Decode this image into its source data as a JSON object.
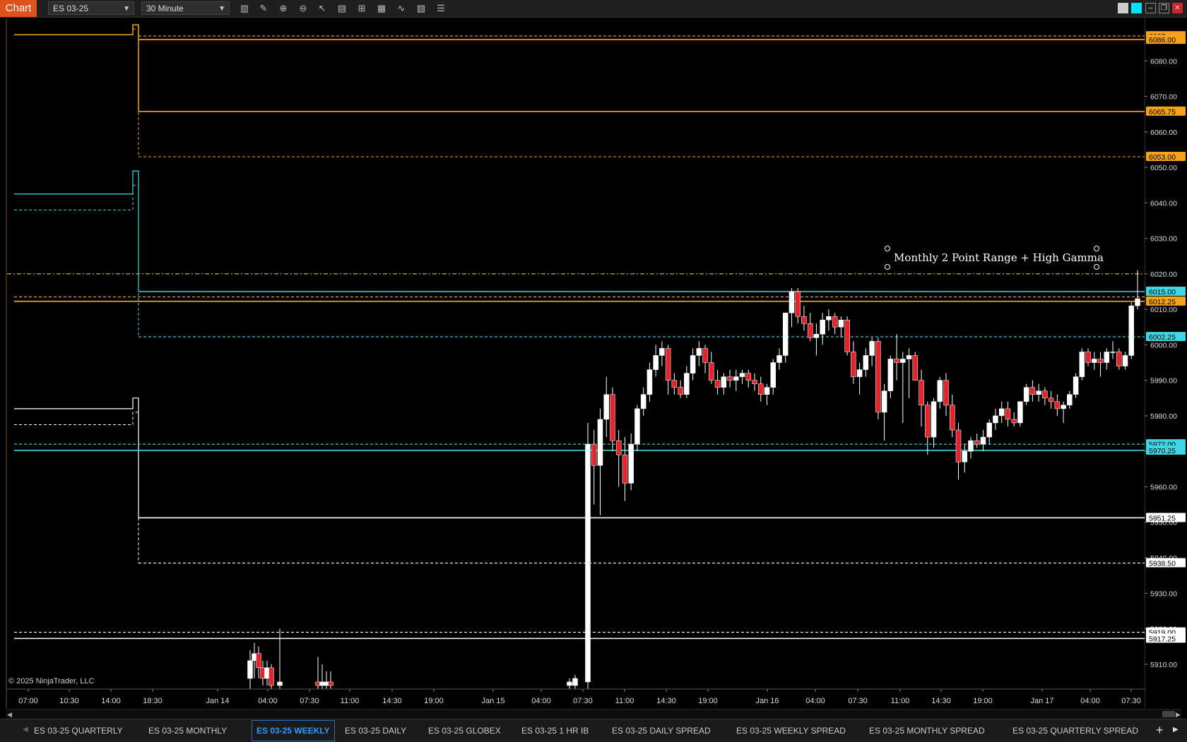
{
  "toolbar": {
    "chart_label": "Chart",
    "instrument": "ES 03-25",
    "interval": "30 Minute",
    "icons": [
      "bar-type-icon",
      "drawing-tool-icon",
      "zoom-in-icon",
      "zoom-out-icon",
      "pointer-icon",
      "properties-icon",
      "templates-icon",
      "data-box-icon",
      "indicators-icon",
      "strategies-icon",
      "chart-trader-icon"
    ]
  },
  "annotation": {
    "text": "Monthly 2 Point Range + High Gamma"
  },
  "copyright": "© 2025 NinjaTrader, LLC",
  "colors": {
    "orange": "#f7a21b",
    "cyan": "#3fd7e3",
    "white": "#ffffff",
    "bull": "#ffffff",
    "bear": "#e3252b",
    "tab_active": "#2f9bff"
  },
  "tabs": [
    {
      "label": "ES 03-25 QUARTERLY"
    },
    {
      "label": "ES 03-25 MONTHLY"
    },
    {
      "label": "ES 03-25 WEEKLY",
      "active": true
    },
    {
      "label": "ES 03-25 DAILY"
    },
    {
      "label": "ES 03-25 GLOBEX"
    },
    {
      "label": "ES 03-25 1 HR IB"
    },
    {
      "label": "ES 03-25 DAILY SPREAD"
    },
    {
      "label": "ES 03-25 WEEKLY SPREAD"
    },
    {
      "label": "ES 03-25 MONTHLY SPREAD"
    },
    {
      "label": "ES 03-25 QUARTERLY SPREAD"
    }
  ],
  "chart_data": {
    "type": "candlestick",
    "ylim": [
      5903,
      6090
    ],
    "y_ticks": [
      5910,
      5920,
      5930,
      5940,
      5950,
      5960,
      5970,
      5980,
      5990,
      6000,
      6010,
      6020,
      6030,
      6040,
      6050,
      6060,
      6070,
      6080
    ],
    "x_labels": [
      "07:00",
      "10:30",
      "14:00",
      "18:30",
      "Jan 14",
      "04:00",
      "07:30",
      "11:00",
      "14:30",
      "19:00",
      "Jan 15",
      "04:00",
      "07:30",
      "11:00",
      "14:30",
      "19:00",
      "Jan 16",
      "04:00",
      "07:30",
      "11:00",
      "14:30",
      "19:00",
      "Jan 17",
      "04:00",
      "07:30"
    ],
    "price_labels": [
      {
        "value": "6087.",
        "price": 6087,
        "color": "orange"
      },
      {
        "value": "6086.00",
        "price": 6086,
        "color": "orange"
      },
      {
        "value": "6065.75",
        "price": 6065.75,
        "color": "orange"
      },
      {
        "value": "6053.00",
        "price": 6053,
        "color": "orange"
      },
      {
        "value": "6015.00",
        "price": 6015,
        "color": "cyan"
      },
      {
        "value": "6012.25",
        "price": 6012.25,
        "color": "orange"
      },
      {
        "value": "6002.25",
        "price": 6002.25,
        "color": "cyan"
      },
      {
        "value": "5972.00",
        "price": 5972,
        "color": "cyan"
      },
      {
        "value": "5970.25",
        "price": 5970.25,
        "color": "cyan"
      },
      {
        "value": "5951.25",
        "price": 5951.25,
        "color": "white"
      },
      {
        "value": "5938.50",
        "price": 5938.5,
        "color": "white"
      },
      {
        "value": "5919.00",
        "price": 5919,
        "color": "white"
      },
      {
        "value": "5917.25",
        "price": 5917.25,
        "color": "white"
      }
    ],
    "levels": [
      {
        "price": 6087,
        "color": "orange",
        "style": "dashed"
      },
      {
        "price": 6086,
        "color": "orange",
        "style": "solid"
      },
      {
        "price": 6065.75,
        "color": "orange",
        "style": "solid"
      },
      {
        "price": 6053,
        "color": "orange",
        "style": "dashed"
      },
      {
        "price": 6020,
        "color": "yellow",
        "style": "dashdot"
      },
      {
        "price": 6015,
        "color": "cyan",
        "style": "solid"
      },
      {
        "price": 6013.5,
        "color": "orange",
        "style": "dashed"
      },
      {
        "price": 6012.25,
        "color": "orange",
        "style": "solid"
      },
      {
        "price": 6002.25,
        "color": "cyan",
        "style": "dashed"
      },
      {
        "price": 5972,
        "color": "cyan",
        "style": "dashed"
      },
      {
        "price": 5970.25,
        "color": "cyan",
        "style": "solid"
      },
      {
        "price": 5951.25,
        "color": "white",
        "style": "solid"
      },
      {
        "price": 5938.5,
        "color": "white",
        "style": "dashed"
      },
      {
        "price": 5919,
        "color": "white",
        "style": "dashed"
      },
      {
        "price": 5917.25,
        "color": "white",
        "style": "solid"
      }
    ],
    "candles": [
      {
        "o": 5906,
        "h": 5914,
        "l": 5903,
        "c": 5911
      },
      {
        "o": 5911,
        "h": 5916,
        "l": 5906,
        "c": 5913
      },
      {
        "o": 5913,
        "h": 5915,
        "l": 5906,
        "c": 5909
      },
      {
        "o": 5909,
        "h": 5911,
        "l": 5904,
        "c": 5906
      },
      {
        "o": 5906,
        "h": 5911,
        "l": 5904,
        "c": 5909
      },
      {
        "o": 5909,
        "h": 5910,
        "l": 5903,
        "c": 5904
      },
      {
        "o": 5904,
        "h": 5920,
        "l": 5903,
        "c": 5905
      },
      {
        "o": 5905,
        "h": 5912,
        "l": 5903,
        "c": 5904
      },
      {
        "o": 5904,
        "h": 5910,
        "l": 5903,
        "c": 5905
      },
      {
        "o": 5904,
        "h": 5908,
        "l": 5903,
        "c": 5905
      },
      {
        "o": 5905,
        "h": 5908,
        "l": 5903,
        "c": 5904
      },
      {
        "o": 5904,
        "h": 5906,
        "l": 5903,
        "c": 5905
      },
      {
        "o": 5904,
        "h": 5907,
        "l": 5903,
        "c": 5906
      },
      {
        "o": 5905,
        "h": 5978,
        "l": 5903,
        "c": 5972
      },
      {
        "o": 5972,
        "h": 5976,
        "l": 5955,
        "c": 5966
      },
      {
        "o": 5966,
        "h": 5982,
        "l": 5952,
        "c": 5979
      },
      {
        "o": 5979,
        "h": 5991,
        "l": 5974,
        "c": 5986
      },
      {
        "o": 5986,
        "h": 5988,
        "l": 5970,
        "c": 5973
      },
      {
        "o": 5973,
        "h": 5976,
        "l": 5960,
        "c": 5969
      },
      {
        "o": 5969,
        "h": 5974,
        "l": 5956,
        "c": 5961
      },
      {
        "o": 5961,
        "h": 5975,
        "l": 5959,
        "c": 5972
      },
      {
        "o": 5972,
        "h": 5983,
        "l": 5970,
        "c": 5982
      },
      {
        "o": 5982,
        "h": 5988,
        "l": 5980,
        "c": 5986
      },
      {
        "o": 5986,
        "h": 5995,
        "l": 5984,
        "c": 5993
      },
      {
        "o": 5993,
        "h": 6000,
        "l": 5991,
        "c": 5997
      },
      {
        "o": 5997,
        "h": 6001,
        "l": 5994,
        "c": 5999
      },
      {
        "o": 5999,
        "h": 6000,
        "l": 5986,
        "c": 5990
      },
      {
        "o": 5990,
        "h": 5992,
        "l": 5986,
        "c": 5988
      },
      {
        "o": 5988,
        "h": 5990,
        "l": 5985,
        "c": 5986
      },
      {
        "o": 5986,
        "h": 5994,
        "l": 5985,
        "c": 5992
      },
      {
        "o": 5992,
        "h": 5999,
        "l": 5990,
        "c": 5997
      },
      {
        "o": 5997,
        "h": 6001,
        "l": 5994,
        "c": 5999
      },
      {
        "o": 5999,
        "h": 6000,
        "l": 5992,
        "c": 5995
      },
      {
        "o": 5995,
        "h": 5998,
        "l": 5989,
        "c": 5990
      },
      {
        "o": 5990,
        "h": 5993,
        "l": 5986,
        "c": 5988
      },
      {
        "o": 5988,
        "h": 5992,
        "l": 5986,
        "c": 5991
      },
      {
        "o": 5991,
        "h": 5993,
        "l": 5988,
        "c": 5990
      },
      {
        "o": 5990,
        "h": 5993,
        "l": 5987,
        "c": 5991
      },
      {
        "o": 5991,
        "h": 5993,
        "l": 5989,
        "c": 5992
      },
      {
        "o": 5992,
        "h": 5993,
        "l": 5988,
        "c": 5990
      },
      {
        "o": 5990,
        "h": 5992,
        "l": 5987,
        "c": 5989
      },
      {
        "o": 5989,
        "h": 5991,
        "l": 5984,
        "c": 5986
      },
      {
        "o": 5986,
        "h": 5989,
        "l": 5983,
        "c": 5988
      },
      {
        "o": 5988,
        "h": 5996,
        "l": 5986,
        "c": 5995
      },
      {
        "o": 5995,
        "h": 5999,
        "l": 5993,
        "c": 5997
      },
      {
        "o": 5997,
        "h": 6009,
        "l": 5995,
        "c": 6009
      },
      {
        "o": 6009,
        "h": 6016,
        "l": 6005,
        "c": 6015
      },
      {
        "o": 6015,
        "h": 6016,
        "l": 6006,
        "c": 6008
      },
      {
        "o": 6008,
        "h": 6011,
        "l": 6004,
        "c": 6006
      },
      {
        "o": 6006,
        "h": 6009,
        "l": 6001,
        "c": 6002
      },
      {
        "o": 6002,
        "h": 6006,
        "l": 5997,
        "c": 6003
      },
      {
        "o": 6003,
        "h": 6009,
        "l": 6000,
        "c": 6007
      },
      {
        "o": 6007,
        "h": 6010,
        "l": 6004,
        "c": 6008
      },
      {
        "o": 6008,
        "h": 6009,
        "l": 6003,
        "c": 6005
      },
      {
        "o": 6005,
        "h": 6008,
        "l": 6002,
        "c": 6007
      },
      {
        "o": 6007,
        "h": 6008,
        "l": 5997,
        "c": 5998
      },
      {
        "o": 5998,
        "h": 6001,
        "l": 5989,
        "c": 5991
      },
      {
        "o": 5991,
        "h": 5995,
        "l": 5986,
        "c": 5993
      },
      {
        "o": 5993,
        "h": 5999,
        "l": 5991,
        "c": 5997
      },
      {
        "o": 5997,
        "h": 6002,
        "l": 5994,
        "c": 6001
      },
      {
        "o": 6001,
        "h": 6002,
        "l": 5979,
        "c": 5981
      },
      {
        "o": 5981,
        "h": 5989,
        "l": 5973,
        "c": 5987
      },
      {
        "o": 5987,
        "h": 5997,
        "l": 5985,
        "c": 5996
      },
      {
        "o": 5996,
        "h": 6003,
        "l": 5990,
        "c": 5995
      },
      {
        "o": 5995,
        "h": 5998,
        "l": 5978,
        "c": 5996
      },
      {
        "o": 5996,
        "h": 5999,
        "l": 5985,
        "c": 5997
      },
      {
        "o": 5997,
        "h": 5998,
        "l": 5990,
        "c": 5990
      },
      {
        "o": 5990,
        "h": 5993,
        "l": 5977,
        "c": 5983
      },
      {
        "o": 5983,
        "h": 5984,
        "l": 5969,
        "c": 5974
      },
      {
        "o": 5974,
        "h": 5985,
        "l": 5971,
        "c": 5984
      },
      {
        "o": 5984,
        "h": 5991,
        "l": 5982,
        "c": 5990
      },
      {
        "o": 5990,
        "h": 5992,
        "l": 5980,
        "c": 5983
      },
      {
        "o": 5983,
        "h": 5986,
        "l": 5974,
        "c": 5976
      },
      {
        "o": 5976,
        "h": 5978,
        "l": 5962,
        "c": 5967
      },
      {
        "o": 5967,
        "h": 5972,
        "l": 5964,
        "c": 5970
      },
      {
        "o": 5970,
        "h": 5974,
        "l": 5968,
        "c": 5973
      },
      {
        "o": 5973,
        "h": 5975,
        "l": 5971,
        "c": 5972
      },
      {
        "o": 5972,
        "h": 5976,
        "l": 5970,
        "c": 5974
      },
      {
        "o": 5974,
        "h": 5979,
        "l": 5972,
        "c": 5978
      },
      {
        "o": 5978,
        "h": 5982,
        "l": 5976,
        "c": 5980
      },
      {
        "o": 5980,
        "h": 5984,
        "l": 5978,
        "c": 5982
      },
      {
        "o": 5982,
        "h": 5984,
        "l": 5977,
        "c": 5979
      },
      {
        "o": 5979,
        "h": 5981,
        "l": 5977,
        "c": 5978
      },
      {
        "o": 5978,
        "h": 5984,
        "l": 5977,
        "c": 5984
      },
      {
        "o": 5984,
        "h": 5989,
        "l": 5983,
        "c": 5988
      },
      {
        "o": 5988,
        "h": 5990,
        "l": 5984,
        "c": 5986
      },
      {
        "o": 5986,
        "h": 5989,
        "l": 5984,
        "c": 5987
      },
      {
        "o": 5987,
        "h": 5988,
        "l": 5983,
        "c": 5985
      },
      {
        "o": 5985,
        "h": 5987,
        "l": 5982,
        "c": 5984
      },
      {
        "o": 5984,
        "h": 5986,
        "l": 5980,
        "c": 5982
      },
      {
        "o": 5982,
        "h": 5984,
        "l": 5978,
        "c": 5983
      },
      {
        "o": 5983,
        "h": 5987,
        "l": 5982,
        "c": 5986
      },
      {
        "o": 5986,
        "h": 5992,
        "l": 5985,
        "c": 5991
      },
      {
        "o": 5991,
        "h": 5999,
        "l": 5990,
        "c": 5998
      },
      {
        "o": 5998,
        "h": 5999,
        "l": 5994,
        "c": 5995
      },
      {
        "o": 5995,
        "h": 5998,
        "l": 5993,
        "c": 5996
      },
      {
        "o": 5996,
        "h": 5998,
        "l": 5991,
        "c": 5995
      },
      {
        "o": 5995,
        "h": 5999,
        "l": 5993,
        "c": 5998
      },
      {
        "o": 5998,
        "h": 6001,
        "l": 5996,
        "c": 5998
      },
      {
        "o": 5998,
        "h": 5999,
        "l": 5993,
        "c": 5994
      },
      {
        "o": 5994,
        "h": 5998,
        "l": 5993,
        "c": 5997
      },
      {
        "o": 5997,
        "h": 6012,
        "l": 5996,
        "c": 6011
      },
      {
        "o": 6011,
        "h": 6021,
        "l": 6010,
        "c": 6013
      }
    ]
  }
}
